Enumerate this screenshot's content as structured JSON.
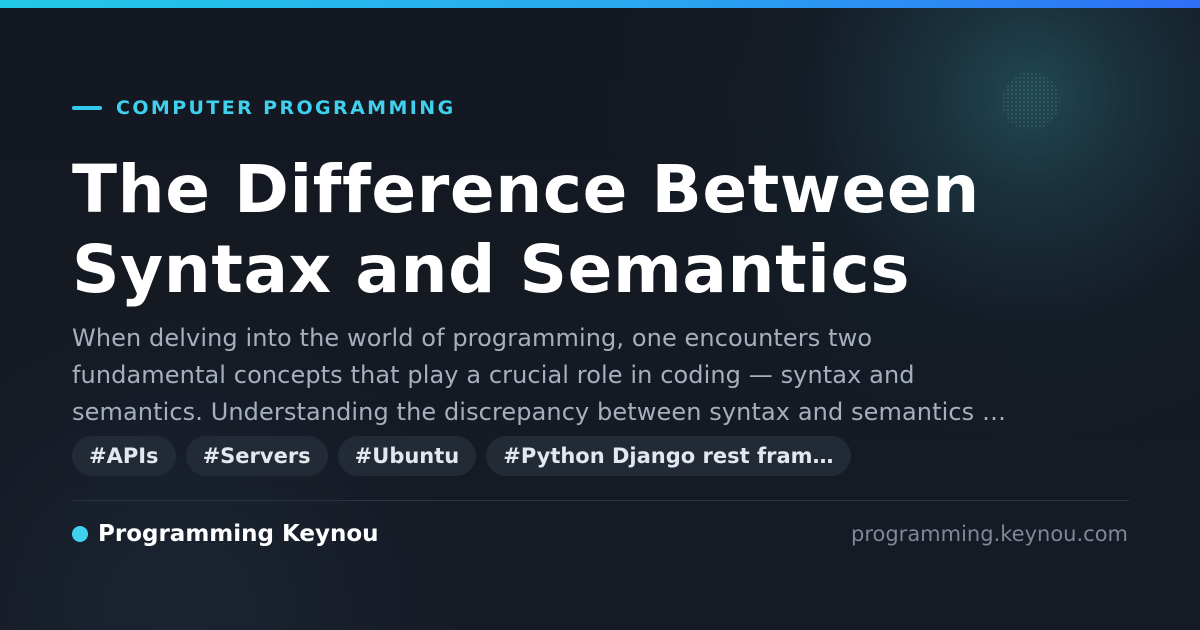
{
  "header": {
    "category": "COMPUTER PROGRAMMING",
    "title_lines": [
      "The Difference Between",
      "Syntax and Semantics"
    ]
  },
  "article": {
    "description_lines": [
      "When delving into the world of programming, one encounters two",
      "fundamental concepts that play a crucial role in coding — syntax and",
      "semantics. Understanding the discrepancy between syntax and semantics …"
    ]
  },
  "tags": [
    "#APIs",
    "#Servers",
    "#Ubuntu",
    "#Python Django rest fram…"
  ],
  "footer": {
    "site_name": "Programming Keynou",
    "site_url": "programming.keynou.com"
  },
  "colors": {
    "accent": "#3fd0ee",
    "background": "#141821",
    "title": "#ffffff",
    "description": "#a6afbc",
    "tag_background": "#222a35",
    "url": "#7e8896"
  },
  "icons": {
    "kicker_marker": "accent-dash-icon",
    "site_marker": "status-dot-icon"
  }
}
